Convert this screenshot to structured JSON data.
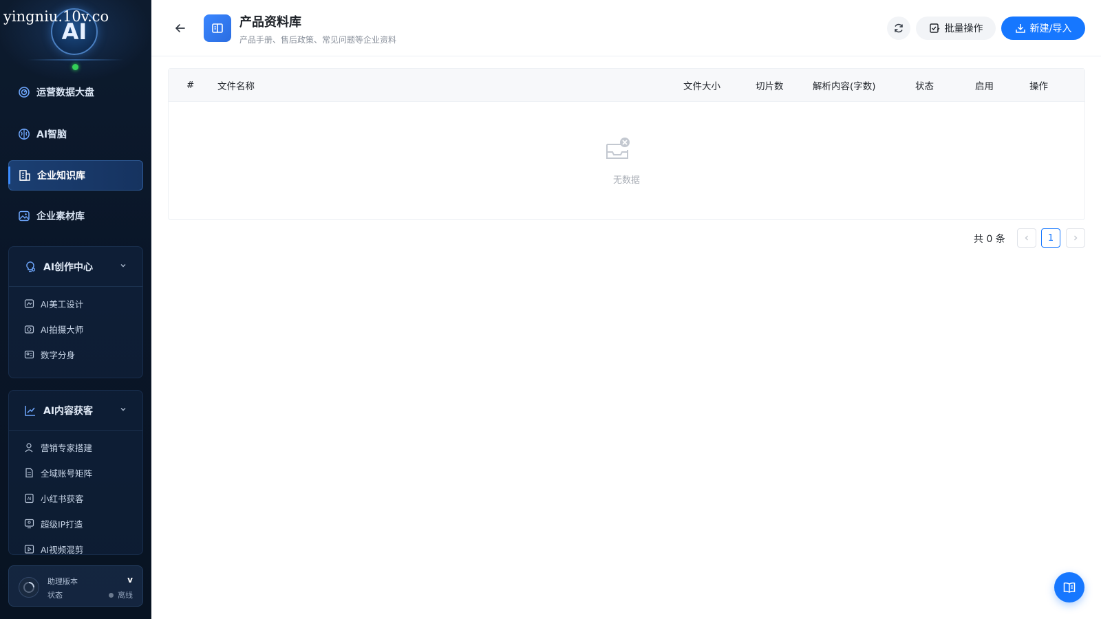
{
  "watermark": "yingniu.10v.co",
  "logo_text": "AI",
  "sidebar": {
    "items": [
      {
        "label": "运营数据大盘",
        "icon": "dashboard-icon"
      },
      {
        "label": "AI智脑",
        "icon": "brain-icon"
      },
      {
        "label": "企业知识库",
        "icon": "knowledge-base-icon",
        "active": true
      },
      {
        "label": "企业素材库",
        "icon": "image-library-icon"
      }
    ],
    "groups": [
      {
        "label": "AI创作中心",
        "icon": "lightbulb-gear-icon",
        "children": [
          {
            "label": "AI美工设计",
            "icon": "design-icon"
          },
          {
            "label": "AI拍摄大师",
            "icon": "camera-icon"
          },
          {
            "label": "数字分身",
            "icon": "id-card-icon"
          }
        ]
      },
      {
        "label": "AI内容获客",
        "icon": "trend-chart-icon",
        "children": [
          {
            "label": "营销专家搭建",
            "icon": "user-icon"
          },
          {
            "label": "全域账号矩阵",
            "icon": "document-icon"
          },
          {
            "label": "小红书获客",
            "icon": "ai-doc-icon"
          },
          {
            "label": "超级IP打造",
            "icon": "monitor-user-icon"
          },
          {
            "label": "AI视频混剪",
            "icon": "video-icon"
          }
        ]
      }
    ],
    "version": {
      "label": "助理版本",
      "value": "v",
      "status_label": "状态",
      "status_value": "离线"
    }
  },
  "header": {
    "title": "产品资料库",
    "subtitle": "产品手册、售后政策、常见问题等企业资料",
    "batch_label": "批量操作",
    "new_label": "新建/导入"
  },
  "table": {
    "columns": [
      "#",
      "文件名称",
      "文件大小",
      "切片数",
      "解析内容(字数)",
      "状态",
      "启用",
      "操作"
    ],
    "rows": [],
    "empty_text": "无数据"
  },
  "pagination": {
    "total_text": "共 0 条",
    "current_page": "1"
  },
  "colors": {
    "primary": "#1677ff",
    "sidebar_bg": "#0a1628",
    "online": "#34d058"
  }
}
